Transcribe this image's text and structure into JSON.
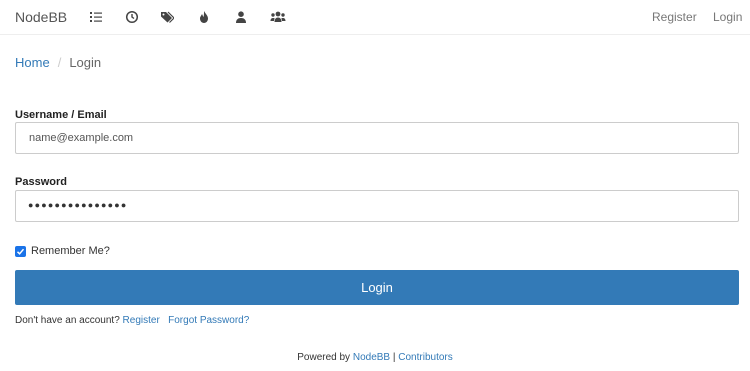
{
  "nav": {
    "brand": "NodeBB",
    "icons": [
      "list-icon",
      "clock-icon",
      "tags-icon",
      "fire-icon",
      "user-icon",
      "users-icon"
    ],
    "register": "Register",
    "login": "Login"
  },
  "breadcrumb": {
    "home": "Home",
    "separator": "/",
    "current": "Login"
  },
  "form": {
    "username_label": "Username / Email",
    "username_placeholder": "name@example.com",
    "password_label": "Password",
    "password_value": "●●●●●●●●●●●●●●●",
    "remember_label": "Remember Me?",
    "remember_checked": true,
    "login_button": "Login"
  },
  "account": {
    "prompt": "Don't have an account?",
    "register_link": "Register",
    "forgot_link": "Forgot Password?"
  },
  "footer": {
    "powered_by": "Powered by",
    "nodebb_link": "NodeBB",
    "separator": "|",
    "contributors_link": "Contributors"
  },
  "colors": {
    "accent": "#337ab7",
    "checkbox": "#1a73e8"
  }
}
